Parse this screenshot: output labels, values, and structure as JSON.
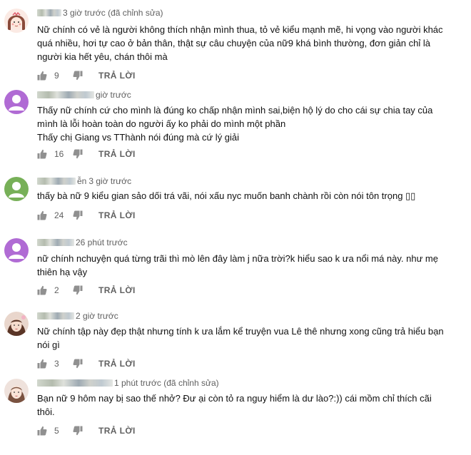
{
  "comments": [
    {
      "timestamp": "3 giờ trước (đã chỉnh sửa)",
      "text": "Nữ chính có vẻ là người không thích nhận mình thua, tỏ vẻ kiểu mạnh mẽ, hi vọng vào người khác quá nhiều, hơi tự cao ở bản thân, thật sự câu chuyện của nữ9 khá bình thường, đơn giản chỉ là người kia hết yêu, chán thôi mà",
      "likes": "9",
      "reply_label": "TRẢ LỜI",
      "avatar": "cartoon-girl"
    },
    {
      "timestamp": "giờ trước",
      "text": "Thấy nữ chính cứ cho mình là đúng ko chấp nhận mình sai,biện hộ lý do cho cái sự chia tay của mình là lỗi hoàn toàn do người ấy ko phải do mình một phần\nThấy chị Giang vs TThành nói đúng mà cứ lý giải",
      "likes": "16",
      "reply_label": "TRẢ LỜI",
      "avatar": "default-purple"
    },
    {
      "name_suffix": "ễn",
      "timestamp": "3 giờ trước",
      "text": "thấy bà nữ 9 kiểu gian sảo dối trá vãi, nói xấu nyc muốn banh chành rồi còn nói tôn trọng ▯▯",
      "likes": "24",
      "reply_label": "TRẢ LỜI",
      "avatar": "default-green"
    },
    {
      "timestamp": "26 phút trước",
      "text": "nữ chính nchuyện quá từng trãi thì mò lên đây làm j nữa trời?k hiểu sao k ưa nổi má này. như mẹ thiên hạ vậy",
      "likes": "2",
      "reply_label": "TRẢ LỜI",
      "avatar": "default-purple"
    },
    {
      "timestamp": "2 giờ trước",
      "text": "Nữ chính tập này đẹp thật nhưng tính k ưa lắm kể truyện vua Lê thê nhưng xong cũng trả hiểu bạn nói gì",
      "likes": "3",
      "reply_label": "TRẢ LỜI",
      "avatar": "photo-girl"
    },
    {
      "timestamp": "1 phút trước (đã chỉnh sửa)",
      "text": "Bạn nữ 9 hôm nay bị sao thế nhở? Đư      ại còn tỏ ra nguy hiểm là dư lào?:)) cái mồm chỉ thích cãi thôi.",
      "likes": "5",
      "reply_label": "TRẢ LỜI",
      "avatar": "photo-girl-2"
    }
  ],
  "colors": {
    "avatar_purple": "#b06bd4",
    "avatar_green": "#77b058",
    "meta_text": "#606060",
    "body_text": "#111111"
  },
  "icons": {
    "like": "thumbs-up-icon",
    "dislike": "thumbs-down-icon"
  }
}
